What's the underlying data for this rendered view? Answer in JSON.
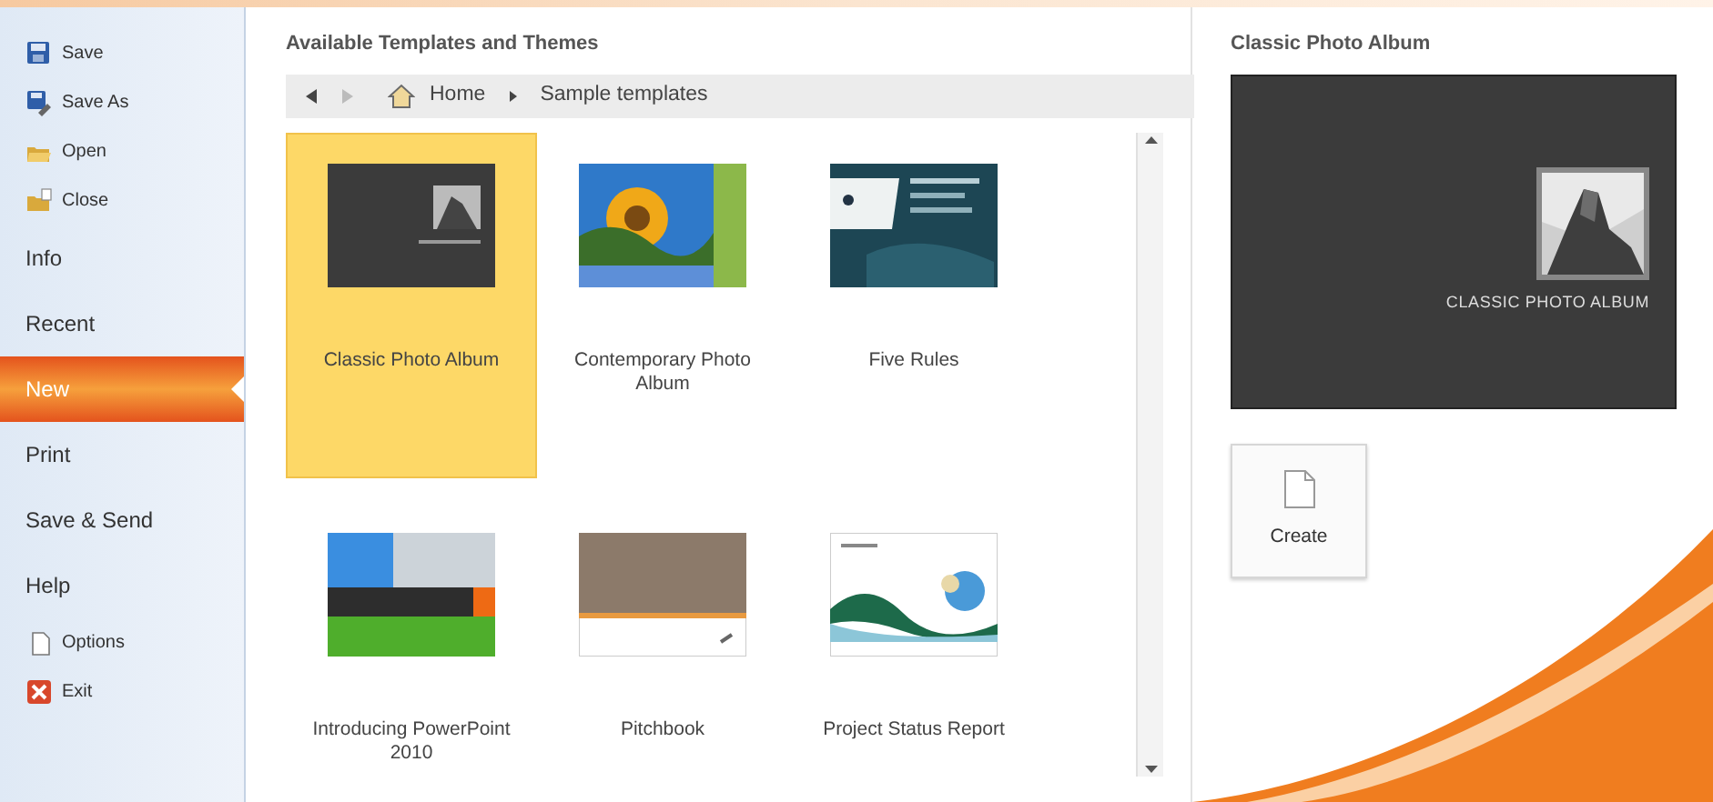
{
  "sidebar": {
    "items": [
      {
        "label": "Save",
        "kind": "command",
        "selected": false
      },
      {
        "label": "Save As",
        "kind": "command",
        "selected": false
      },
      {
        "label": "Open",
        "kind": "command",
        "selected": false
      },
      {
        "label": "Close",
        "kind": "command",
        "selected": false
      },
      {
        "label": "Info",
        "kind": "tab",
        "selected": false
      },
      {
        "label": "Recent",
        "kind": "tab",
        "selected": false
      },
      {
        "label": "New",
        "kind": "tab",
        "selected": true
      },
      {
        "label": "Print",
        "kind": "tab",
        "selected": false
      },
      {
        "label": "Save & Send",
        "kind": "tab",
        "selected": false
      },
      {
        "label": "Help",
        "kind": "tab",
        "selected": false
      },
      {
        "label": "Options",
        "kind": "command",
        "selected": false
      },
      {
        "label": "Exit",
        "kind": "command",
        "selected": false
      }
    ]
  },
  "templates": {
    "title": "Available Templates and Themes",
    "breadcrumb": {
      "back_disabled": false,
      "forward_disabled": true,
      "items": [
        "Home",
        "Sample templates"
      ]
    },
    "items": [
      {
        "label": "Classic Photo Album",
        "selected": true
      },
      {
        "label": "Contemporary Photo Album",
        "selected": false
      },
      {
        "label": "Five Rules",
        "selected": false
      },
      {
        "label": "Introducing PowerPoint 2010",
        "selected": false
      },
      {
        "label": "Pitchbook",
        "selected": false
      },
      {
        "label": "Project Status Report",
        "selected": false
      }
    ]
  },
  "preview": {
    "title": "Classic Photo Album",
    "slide_text": "CLASSIC PHOTO ALBUM",
    "create_label": "Create"
  }
}
